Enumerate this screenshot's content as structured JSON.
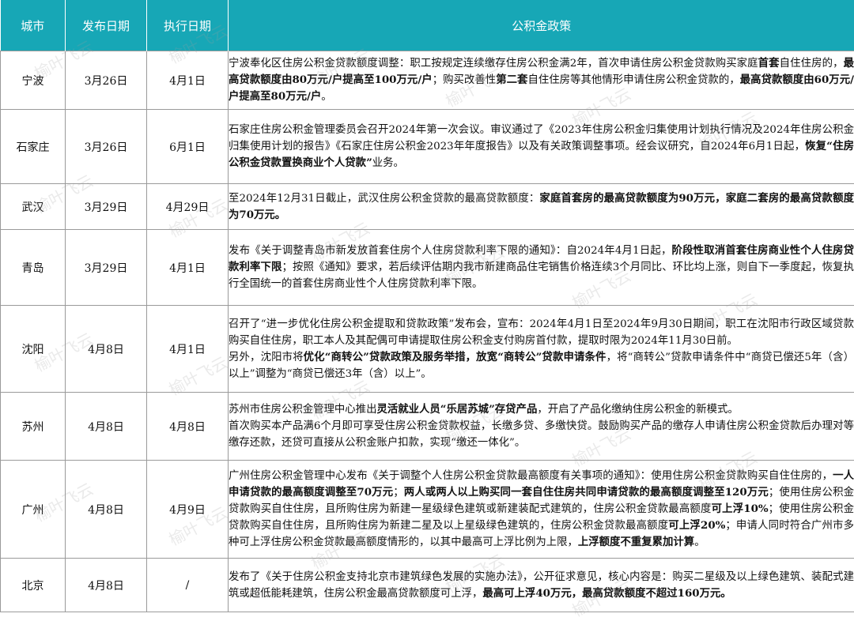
{
  "table": {
    "headers": [
      "城市",
      "发布日期",
      "执行日期",
      "公积金政策"
    ],
    "rows": [
      {
        "city": "宁波",
        "release": "3月26日",
        "effective": "4月1日",
        "policy": [
          [
            {
              "t": "宁波奉化区住房公积金贷款额度调整：职工按规定连续缴存住房公积金满2年，首次申请住房公积金贷款购买家庭"
            },
            {
              "t": "首套",
              "b": true
            },
            {
              "t": "自住住房的，"
            },
            {
              "t": "最高贷款额度由80万元/户提高至100万元/户",
              "b": true
            },
            {
              "t": "；购买改善性"
            },
            {
              "t": "第二套",
              "b": true
            },
            {
              "t": "自住住房等其他情形申请住房公积金贷款的，"
            },
            {
              "t": "最高贷款额度由60万元/户提高至80万元/户",
              "b": true
            },
            {
              "t": "。"
            }
          ]
        ]
      },
      {
        "city": "石家庄",
        "release": "3月26日",
        "effective": "6月1日",
        "policy": [
          [
            {
              "t": "石家庄住房公积金管理委员会召开2024年第一次会议。审议通过了《2023年住房公积金归集使用计划执行情况及2024年住房公积金归集使用计划的报告》《石家庄住房公积金2023年年度报告》以及有关政策调整事项。经会议研究，自2024年6月1日起，"
            },
            {
              "t": "恢复“住房公积金贷款置换商业个人贷款”",
              "b": true
            },
            {
              "t": "业务。"
            }
          ]
        ]
      },
      {
        "city": "武汉",
        "release": "3月29日",
        "effective": "4月29日",
        "policy": [
          [
            {
              "t": "至2024年12月31日截止，武汉住房公积金贷款的最高贷款额度："
            },
            {
              "t": "家庭首套房的最高贷款额度为90万元，家庭二套房的最高贷款额度为70万元。",
              "b": true
            }
          ]
        ]
      },
      {
        "city": "青岛",
        "release": "3月29日",
        "effective": "4月1日",
        "policy": [
          [
            {
              "t": "发布《关于调整青岛市新发放首套住房个人住房贷款利率下限的通知》：自2024年4月1日起，"
            },
            {
              "t": "阶段性取消首套住房商业性个人住房贷款利率下限",
              "b": true
            },
            {
              "t": "；按照《通知》要求，若后续评估期内我市新建商品住宅销售价格连续3个月同比、环比均上涨，则自下一季度起，恢复执行全国统一的首套住房商业性个人住房贷款利率下限。"
            }
          ]
        ]
      },
      {
        "city": "沈阳",
        "release": "4月8日",
        "effective": "4月1日",
        "policy": [
          [
            {
              "t": "召开了“进一步优化住房公积金提取和贷款政策”发布会，宣布：2024年4月1日至2024年9月30日期间，职工在沈阳市行政区域贷款购买自住住房，职工本人及其配偶可申请提取住房公积金支付购房首付款，提取时限为2024年11月30日前。"
            }
          ],
          [
            {
              "t": "另外，沈阳市将"
            },
            {
              "t": "优化“商转公”贷款政策及服务举措，放宽“商转公”贷款申请条件",
              "b": true
            },
            {
              "t": "，将“商转公”贷款申请条件中“商贷已偿还5年（含）以上”调整为“商贷已偿还3年（含）以上”。"
            }
          ]
        ]
      },
      {
        "city": "苏州",
        "release": "4月8日",
        "effective": "4月8日",
        "policy": [
          [
            {
              "t": "苏州市住房公积金管理中心推出"
            },
            {
              "t": "灵活就业人员“乐居苏城”存贷产品",
              "b": true
            },
            {
              "t": "，开启了产品化缴纳住房公积金的新模式。"
            }
          ],
          [
            {
              "t": "首次购买本产品满6个月即可享受住房公积金贷款权益，长缴多贷、多缴快贷。鼓励购买产品的缴存人申请住房公积金贷款后办理对等缴存还款，还贷可直接从公积金账户扣款，实现“缴还一体化”。"
            }
          ]
        ]
      },
      {
        "city": "广州",
        "release": "4月8日",
        "effective": "4月9日",
        "policy": [
          [
            {
              "t": "广州住房公积金管理中心发布《关于调整个人住房公积金贷款最高额度有关事项的通知》：使用住房公积金贷款购买自住住房的，"
            },
            {
              "t": "一人申请贷款的最高额度调整至70万元",
              "b": true
            },
            {
              "t": "；"
            },
            {
              "t": "两人或两人以上购买同一套自住住房共同申请贷款的最高额度调整至120万元",
              "b": true
            },
            {
              "t": "；使用住房公积金贷款购买自住住房，且所购住房为新建一星级绿色建筑或新建装配式建筑的，住房公积金贷款最高额度"
            },
            {
              "t": "可上浮10%",
              "b": true
            },
            {
              "t": "；使用住房公积金贷款购买自住住房，且所购住房为新建二星及以上星级绿色建筑的，住房公积金贷款最高额度"
            },
            {
              "t": "可上浮20%",
              "b": true
            },
            {
              "t": "；申请人同时符合广州市多种可上浮住房公积金贷款最高额度情形的，以其中最高可上浮比例为上限，"
            },
            {
              "t": "上浮额度不重复累加计算",
              "b": true
            },
            {
              "t": "。"
            }
          ]
        ]
      },
      {
        "city": "北京",
        "release": "4月8日",
        "effective": "/",
        "policy": [
          [
            {
              "t": "发布了《关于住房公积金支持北京市建筑绿色发展的实施办法》，公开征求意见，核心内容是：购买二星级及以上绿色建筑、装配式建筑或超低能耗建筑，住房公积金最高贷款额度可上浮，"
            },
            {
              "t": "最高可上浮40万元，最高贷款额度不超过160万元。",
              "b": true
            }
          ]
        ]
      }
    ]
  },
  "watermark": "榆叶飞云"
}
